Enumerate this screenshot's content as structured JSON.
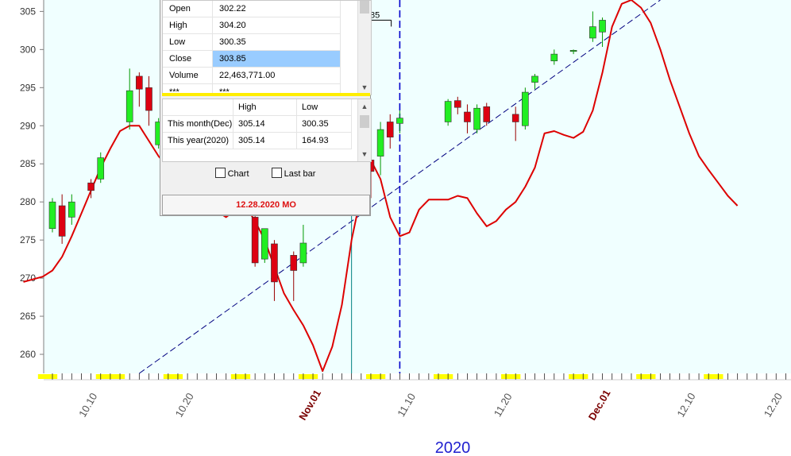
{
  "colors": {
    "up": "#22ee22",
    "down": "#dd0011",
    "ma": "#dd0000",
    "trend": "#000080",
    "plot_bg": "#f0ffff",
    "timeline": "#ffff00",
    "month": "#7a0000",
    "year": "#1f1fcf"
  },
  "chart_data": {
    "type": "candlestick",
    "year_label": "2020",
    "ylim": [
      257.5,
      306.5
    ],
    "y_ticks": [
      260,
      265,
      270,
      275,
      280,
      285,
      290,
      295,
      300,
      305
    ],
    "x_ticks": [
      {
        "label": "10.10",
        "month": false
      },
      {
        "label": "10.20",
        "month": false
      },
      {
        "label": "Nov.01",
        "month": true
      },
      {
        "label": "11.10",
        "month": false
      },
      {
        "label": "11.20",
        "month": false
      },
      {
        "label": "Dec.01",
        "month": true
      },
      {
        "label": "12.10",
        "month": false
      },
      {
        "label": "12.20",
        "month": false
      }
    ],
    "candles": [
      {
        "o": 276.5,
        "h": 280.5,
        "l": 276.0,
        "c": 280.0
      },
      {
        "o": 279.5,
        "h": 281.0,
        "l": 274.5,
        "c": 275.5
      },
      {
        "o": 278.0,
        "h": 281.0,
        "l": 277.0,
        "c": 280.0
      },
      {
        "o": 282.5,
        "h": 283.0,
        "l": 280.5,
        "c": 281.5
      },
      {
        "o": 283.0,
        "h": 286.5,
        "l": 282.5,
        "c": 285.8
      },
      {
        "o": 290.5,
        "h": 297.5,
        "l": 289.5,
        "c": 294.6
      },
      {
        "o": 296.5,
        "h": 297.0,
        "l": 292.5,
        "c": 294.8
      },
      {
        "o": 295.0,
        "h": 296.5,
        "l": 290.0,
        "c": 292.0
      },
      {
        "o": 287.5,
        "h": 291.0,
        "l": 287.0,
        "c": 290.5
      },
      {
        "o": 292.0,
        "h": 293.0,
        "l": 288.5,
        "c": 289.0
      },
      {
        "o": 278.0,
        "h": 279.0,
        "l": 271.5,
        "c": 272.0
      },
      {
        "o": 272.5,
        "h": 276.5,
        "l": 272.0,
        "c": 276.5
      },
      {
        "o": 274.5,
        "h": 275.0,
        "l": 267.0,
        "c": 269.5
      },
      {
        "o": 273.0,
        "h": 273.5,
        "l": 267.0,
        "c": 271.0
      },
      {
        "o": 272.0,
        "h": 277.0,
        "l": 271.5,
        "c": 274.6
      },
      {
        "o": 297.5,
        "h": 299.0,
        "l": 288.0,
        "c": 288.5
      },
      {
        "o": 285.5,
        "h": 286.5,
        "l": 280.5,
        "c": 284.0
      },
      {
        "o": 286.0,
        "h": 290.5,
        "l": 283.5,
        "c": 289.5
      },
      {
        "o": 290.5,
        "h": 291.5,
        "l": 287.0,
        "c": 288.5
      },
      {
        "o": 290.3,
        "h": 292.0,
        "l": 289.0,
        "c": 291.0
      },
      {
        "o": 290.5,
        "h": 293.5,
        "l": 290.0,
        "c": 293.2
      },
      {
        "o": 293.3,
        "h": 293.8,
        "l": 291.5,
        "c": 292.4
      },
      {
        "o": 291.8,
        "h": 292.8,
        "l": 289.0,
        "c": 290.5
      },
      {
        "o": 289.5,
        "h": 292.8,
        "l": 289.0,
        "c": 292.3
      },
      {
        "o": 292.5,
        "h": 293.0,
        "l": 290.0,
        "c": 290.5
      },
      {
        "o": 291.5,
        "h": 292.5,
        "l": 288.0,
        "c": 290.5
      },
      {
        "o": 290.0,
        "h": 295.0,
        "l": 289.5,
        "c": 294.4
      },
      {
        "o": 295.7,
        "h": 296.8,
        "l": 294.8,
        "c": 296.5
      },
      {
        "o": 298.5,
        "h": 300.0,
        "l": 298.0,
        "c": 299.4
      },
      {
        "o": 299.8,
        "h": 300.0,
        "l": 299.4,
        "c": 299.9
      },
      {
        "o": 301.5,
        "h": 305.0,
        "l": 301.0,
        "c": 303.0
      },
      {
        "o": 302.3,
        "h": 304.2,
        "l": 300.35,
        "c": 303.85
      }
    ],
    "ma_line": [
      [
        -3,
        269.5
      ],
      [
        -1,
        270.2
      ],
      [
        0,
        271.0
      ],
      [
        1,
        272.8
      ],
      [
        2,
        275.5
      ],
      [
        3,
        278.5
      ],
      [
        4,
        281.5
      ],
      [
        5,
        284.5
      ],
      [
        6,
        287.0
      ],
      [
        7,
        289.3
      ],
      [
        8,
        290.0
      ],
      [
        9,
        290.0
      ],
      [
        10,
        288.0
      ],
      [
        11,
        286.0
      ],
      [
        12,
        284.5
      ],
      [
        13,
        283.0
      ],
      [
        14,
        282.5
      ],
      [
        15,
        281.5
      ],
      [
        16,
        280.0
      ],
      [
        17,
        278.8
      ],
      [
        18,
        278.0
      ],
      [
        19,
        279.0
      ],
      [
        20,
        279.5
      ],
      [
        21,
        277.5
      ],
      [
        22,
        275.0
      ],
      [
        23,
        271.5
      ],
      [
        24,
        268.0
      ],
      [
        25,
        265.8
      ],
      [
        26,
        263.8
      ],
      [
        27,
        261.2
      ],
      [
        28,
        257.8
      ],
      [
        29,
        261.0
      ],
      [
        30,
        266.5
      ],
      [
        31,
        275.0
      ],
      [
        32,
        281.0
      ],
      [
        33,
        285.5
      ],
      [
        34,
        283.0
      ],
      [
        35,
        278.0
      ],
      [
        36,
        275.5
      ],
      [
        37,
        276.0
      ],
      [
        38,
        279.0
      ],
      [
        39,
        280.3
      ],
      [
        40,
        280.3
      ],
      [
        41,
        280.3
      ],
      [
        42,
        280.8
      ],
      [
        43,
        280.5
      ],
      [
        44,
        278.5
      ],
      [
        45,
        276.8
      ],
      [
        46,
        277.5
      ],
      [
        47,
        279.0
      ],
      [
        48,
        280.0
      ],
      [
        49,
        282.0
      ],
      [
        50,
        284.5
      ],
      [
        51,
        289.0
      ],
      [
        52,
        289.3
      ],
      [
        53,
        288.8
      ],
      [
        54,
        288.4
      ],
      [
        55,
        289.2
      ],
      [
        56,
        292.0
      ],
      [
        57,
        297.0
      ],
      [
        58,
        303.0
      ],
      [
        59,
        306.0
      ],
      [
        60,
        306.5
      ],
      [
        61,
        305.5
      ],
      [
        62,
        303.5
      ],
      [
        63,
        300.0
      ],
      [
        64,
        296.0
      ],
      [
        65,
        292.5
      ],
      [
        66,
        289.0
      ],
      [
        67,
        286.0
      ],
      [
        68,
        284.2
      ],
      [
        69,
        282.5
      ],
      [
        70,
        280.8
      ],
      [
        71,
        279.5
      ]
    ],
    "trend_line": {
      "x0": 9,
      "y0": 257.5,
      "x1": 63,
      "y1": 306.5
    },
    "cursor_index": 31,
    "future_index": 36,
    "last_close_flag": "303.85"
  },
  "panel": {
    "ohlc_rows": [
      {
        "label": "Open",
        "value": "302.22"
      },
      {
        "label": "High",
        "value": "304.20"
      },
      {
        "label": "Low",
        "value": "300.35"
      },
      {
        "label": "Close",
        "value": "303.85"
      },
      {
        "label": "Volume",
        "value": "22,463,771.00"
      },
      {
        "label": "***",
        "value": "***"
      }
    ],
    "hl_header": {
      "col1": "High",
      "col2": "Low"
    },
    "hl_rows": [
      {
        "label": "This month(Dec)",
        "high": "305.14",
        "low": "300.35"
      },
      {
        "label": "This year(2020)",
        "high": "305.14",
        "low": "164.93"
      }
    ],
    "chart_checkbox": "Chart",
    "lastbar_checkbox": "Last bar",
    "date_label": "12.28.2020 MO"
  }
}
